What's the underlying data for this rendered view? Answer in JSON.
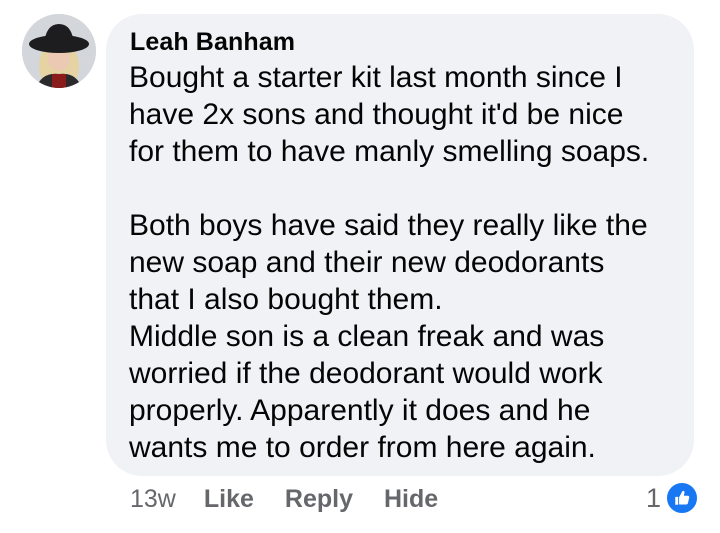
{
  "comment": {
    "author": "Leah Banham",
    "paragraphs": [
      [
        "Bought a starter kit last month since I",
        "have 2x sons and thought it'd be nice",
        "for them to have manly smelling soaps."
      ],
      [
        "Both boys have said they really like the",
        "new soap and their new deodorants",
        "that I also bought them.",
        "Middle son is a clean freak and was",
        "worried if the deodorant would work",
        "properly. Apparently it does and he",
        "wants me to order from here again."
      ]
    ],
    "timestamp": "13w",
    "actions": {
      "like": "Like",
      "reply": "Reply",
      "hide": "Hide"
    },
    "reaction_count": "1",
    "reaction_icon": "thumbs-up-icon",
    "colors": {
      "bubble": "#f0f2f5",
      "text": "#050505",
      "secondary": "#65676b",
      "like_blue": "#1877f2"
    }
  }
}
